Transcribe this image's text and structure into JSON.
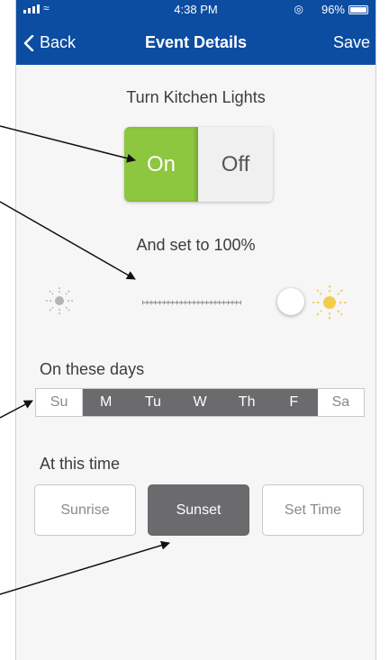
{
  "status_bar": {
    "time": "4:38 PM",
    "battery": "96%"
  },
  "nav": {
    "back_label": "Back",
    "title": "Event Details",
    "save_label": "Save"
  },
  "device": {
    "heading": "Turn Kitchen Lights"
  },
  "toggle": {
    "on_label": "On",
    "off_label": "Off",
    "selected": "On"
  },
  "brightness": {
    "heading": "And set to 100%",
    "level_percent": 100
  },
  "days": {
    "heading": "On these days",
    "items": [
      {
        "label": "Su",
        "selected": false
      },
      {
        "label": "M",
        "selected": true
      },
      {
        "label": "Tu",
        "selected": true
      },
      {
        "label": "W",
        "selected": true
      },
      {
        "label": "Th",
        "selected": true
      },
      {
        "label": "F",
        "selected": true
      },
      {
        "label": "Sa",
        "selected": false
      }
    ]
  },
  "time": {
    "heading": "At this time",
    "options": [
      {
        "label": "Sunrise",
        "selected": false
      },
      {
        "label": "Sunset",
        "selected": true
      },
      {
        "label": "Set Time",
        "selected": false
      }
    ]
  },
  "colors": {
    "header": "#0c4da2",
    "on_green": "#8dc63f",
    "selected_gray": "#6b6b6e",
    "sun_yellow": "#f5cc4a",
    "sun_gray": "#b5b5b5"
  }
}
